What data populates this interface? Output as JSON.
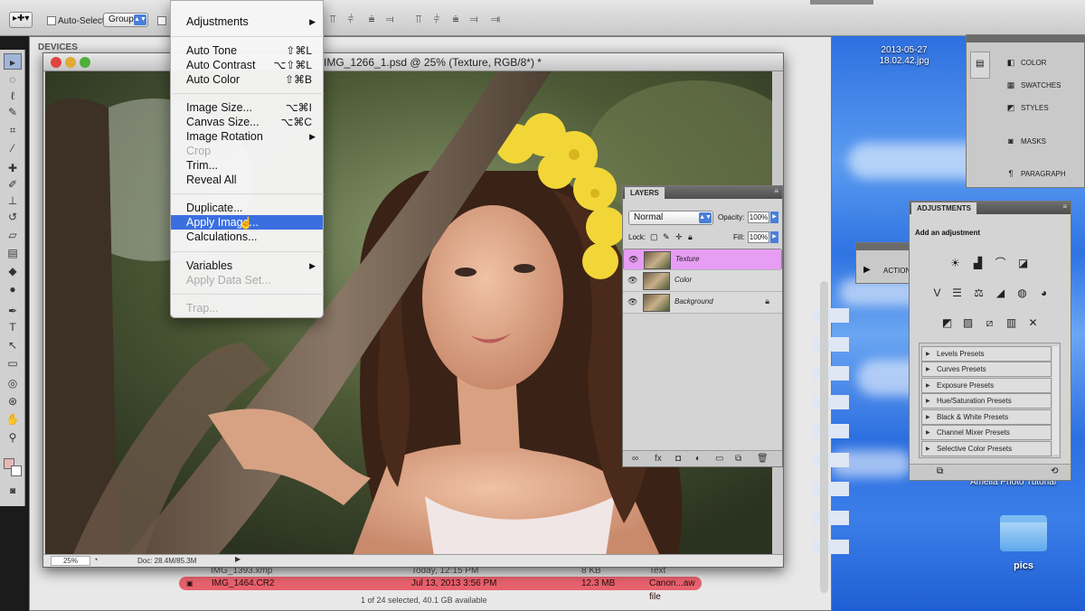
{
  "options_bar": {
    "auto_select_label": "Auto-Select:",
    "group_value": "Group"
  },
  "finder": {
    "devices_label": "DEVICES",
    "row_prev": {
      "name": "IMG_1393.xmp",
      "date": "Today, 12:15 PM",
      "size": "8 KB",
      "kind": "Text"
    },
    "row_selected": {
      "name": "IMG_1464.CR2",
      "date": "Jul 13, 2013 3:56 PM",
      "size": "12.3 MB",
      "kind": "Canon...aw file"
    },
    "footer": "1 of 24 selected, 40.1 GB available"
  },
  "document": {
    "title": "IMG_1266_1.psd @ 25% (Texture, RGB/8*) *",
    "zoom": "25%",
    "doc_info": "Doc: 28.4M/85.3M"
  },
  "menu": {
    "items": [
      {
        "label": "Adjustments",
        "submenu": true
      },
      {
        "label": "Auto Tone",
        "shortcut": "⇧⌘L"
      },
      {
        "label": "Auto Contrast",
        "shortcut": "⌥⇧⌘L"
      },
      {
        "label": "Auto Color",
        "shortcut": "⇧⌘B"
      },
      {
        "label": "Image Size...",
        "shortcut": "⌥⌘I"
      },
      {
        "label": "Canvas Size...",
        "shortcut": "⌥⌘C"
      },
      {
        "label": "Image Rotation",
        "submenu": true
      },
      {
        "label": "Crop",
        "disabled": true
      },
      {
        "label": "Trim..."
      },
      {
        "label": "Reveal All"
      },
      {
        "label": "Duplicate..."
      },
      {
        "label": "Apply Image...",
        "highlighted": true
      },
      {
        "label": "Calculations..."
      },
      {
        "label": "Variables",
        "submenu": true
      },
      {
        "label": "Apply Data Set...",
        "disabled": true
      },
      {
        "label": "Trap...",
        "disabled": true
      }
    ]
  },
  "layers_panel": {
    "tab": "LAYERS",
    "blend_mode": "Normal",
    "opacity_label": "Opacity:",
    "opacity_value": "100%",
    "lock_label": "Lock:",
    "fill_label": "Fill:",
    "fill_value": "100%",
    "layers": [
      {
        "name": "Texture",
        "selected": true
      },
      {
        "name": "Color",
        "selected": false
      },
      {
        "name": "Background",
        "selected": false,
        "locked": true
      }
    ]
  },
  "adjustments_panel": {
    "tab": "ADJUSTMENTS",
    "subtitle": "Add an adjustment",
    "presets": [
      "Levels Presets",
      "Curves Presets",
      "Exposure Presets",
      "Hue/Saturation Presets",
      "Black & White Presets",
      "Channel Mixer Presets",
      "Selective Color Presets"
    ]
  },
  "dock": {
    "items": [
      "COLOR",
      "SWATCHES",
      "STYLES",
      "MASKS",
      "PARAGRAPH"
    ],
    "actions_label": "ACTION"
  },
  "desktop": {
    "file_label_line1": "2013-05-27",
    "file_label_line2": "18.02.42.jpg",
    "folder_label": "pics",
    "watermark": "Amelia Photo Tutorial"
  },
  "colors": {
    "menu_highlight": "#3b6fe0",
    "selected_layer": "#e79df4",
    "finder_selected_row": "#e8626e",
    "desktop_blue": "#2d6fe0"
  }
}
